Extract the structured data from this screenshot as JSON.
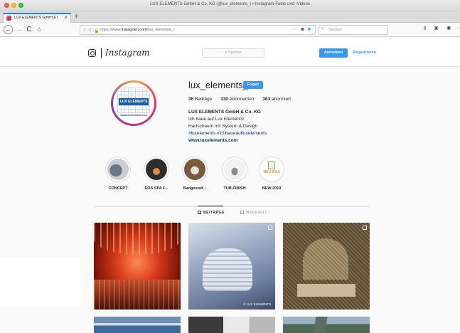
{
  "window": {
    "title": "LUX ELEMENTS GmbH & Co. KG (@lux_elements_) • Instagram-Fotos und -Videos"
  },
  "tab": {
    "title": "LUX ELEMENTS GmbH & Co. K",
    "close": "×",
    "new_tab": "+"
  },
  "toolbar": {
    "back": "←",
    "forward": "→",
    "reload": "C",
    "home": "⌂",
    "url_icons": "ⓘ ⓘ",
    "url_lock": "🔒",
    "url_prefix": "https://www.",
    "url_domain": "instagram.com",
    "url_path": "/lux_elements_/",
    "url_actions_more": "···",
    "url_actions_pocket": "◙",
    "url_actions_star": "★",
    "search_glyph": "⌕",
    "search_placeholder": "Suchen",
    "right_icons": "⫴ ▣ ◉ ≡"
  },
  "instagram": {
    "wordmark": "Instagram",
    "search_placeholder": "⌕ Suchen",
    "login_label": "Anmelden",
    "register_label": "Registrieren"
  },
  "profile": {
    "avatar_brand": "LUX ELEMENTS",
    "avatar_url": "www.luxelements.com",
    "username": "lux_elements_",
    "follow_label": "Folgen",
    "stats": [
      {
        "value": "36",
        "label": "Beiträge"
      },
      {
        "value": "330",
        "label": "Abonnenten"
      },
      {
        "value": "363",
        "label": "abonniert"
      }
    ],
    "bio": {
      "name": "LUX ELEMENTS GmbH & Co. KG",
      "line1": "Ich baue auf Lux Elements!",
      "line2": "Hartschaum mit System & Design",
      "tags": "#luxelements #ichbaueaufluxelements",
      "website": "www.luxelements.com"
    }
  },
  "highlights": [
    {
      "label": "CONCEPT"
    },
    {
      "label": "EOS SPA F..."
    },
    {
      "label": "Badgestalt..."
    },
    {
      "label": "TUB-FINISH"
    },
    {
      "label": "NEW 2019",
      "badge": "NEU 2019"
    }
  ],
  "profile_tabs": {
    "posts": "BEITRÄGE",
    "tagged": "MARKIERT"
  },
  "posts": {
    "watermark": "© LUX ELEMENTS"
  }
}
